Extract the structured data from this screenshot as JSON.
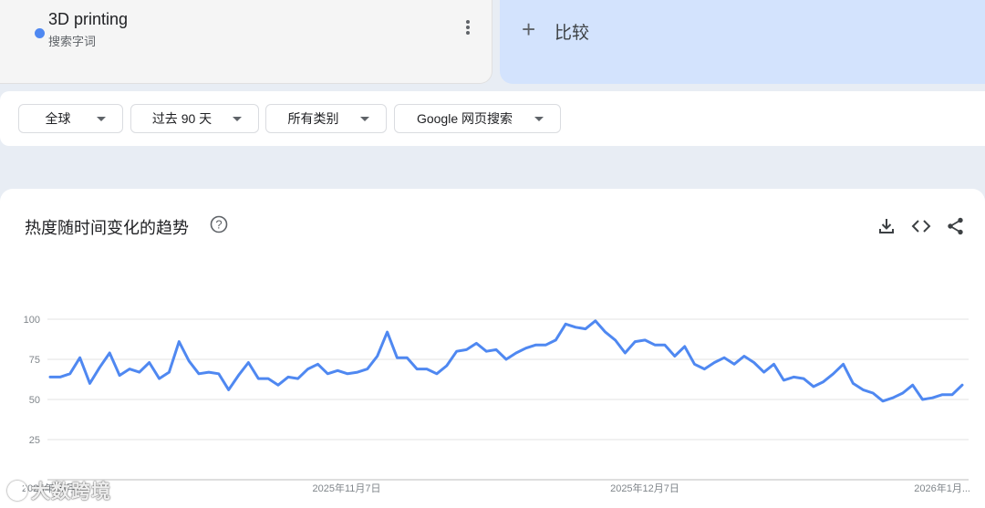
{
  "term": {
    "title": "3D printing",
    "subtitle": "搜索字词",
    "dot_color": "#4f88f1"
  },
  "compare": {
    "label": "比较",
    "icon": "plus-icon"
  },
  "filters": [
    {
      "label": "全球"
    },
    {
      "label": "过去 90 天"
    },
    {
      "label": "所有类别"
    },
    {
      "label": "Google 网页搜索"
    }
  ],
  "chart_card": {
    "title": "热度随时间变化的趋势",
    "icons": [
      "help-icon",
      "download-icon",
      "embed-code-icon",
      "share-icon"
    ]
  },
  "watermark": {
    "text": "大数跨境"
  },
  "chart_data": {
    "type": "line",
    "title": "",
    "xlabel": "",
    "ylabel": "",
    "ylim": [
      0,
      100
    ],
    "yticks": [
      100,
      75,
      50,
      25
    ],
    "xtick_labels": [
      "2025年11月7日",
      "2025年12月7日",
      "2026年1月..."
    ],
    "x_start_label": "2025年10月...",
    "line_color": "#4f88f1",
    "grid": true,
    "series": [
      {
        "values": [
          64,
          64,
          66,
          76,
          60,
          70,
          79,
          65,
          69,
          67,
          73,
          63,
          67,
          86,
          74,
          66,
          67,
          66,
          56,
          65,
          73,
          63,
          63,
          59,
          64,
          63,
          69,
          72,
          66,
          68,
          66,
          67,
          69,
          77,
          92,
          76,
          76,
          69,
          69,
          66,
          71,
          80,
          81,
          85,
          80,
          81,
          75,
          79,
          82,
          84,
          84,
          87,
          97,
          95,
          94,
          99,
          92,
          87,
          79,
          86,
          87,
          84,
          84,
          77,
          83,
          72,
          69,
          73,
          76,
          72,
          77,
          73,
          67,
          72,
          62,
          64,
          63,
          58,
          61,
          66,
          72,
          60,
          56,
          54,
          49,
          51,
          54,
          59,
          50,
          51,
          53,
          53,
          59
        ]
      }
    ]
  }
}
